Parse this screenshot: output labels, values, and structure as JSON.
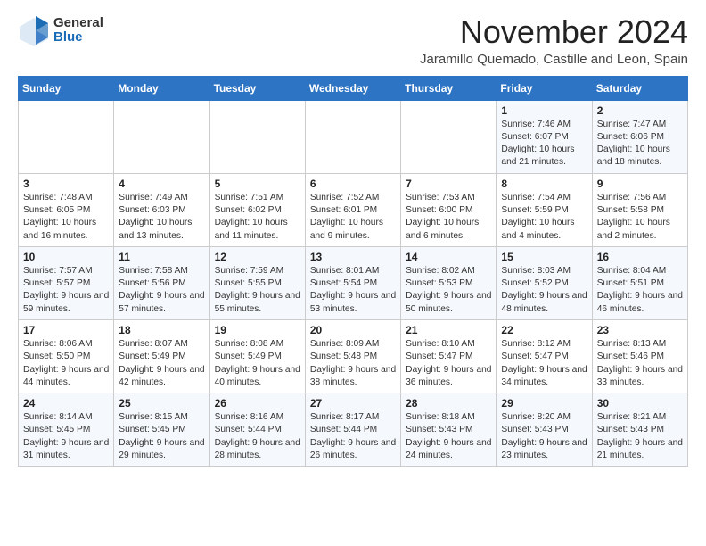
{
  "header": {
    "logo_general": "General",
    "logo_blue": "Blue",
    "month_title": "November 2024",
    "location": "Jaramillo Quemado, Castille and Leon, Spain"
  },
  "calendar": {
    "days_of_week": [
      "Sunday",
      "Monday",
      "Tuesday",
      "Wednesday",
      "Thursday",
      "Friday",
      "Saturday"
    ],
    "weeks": [
      [
        {
          "day": "",
          "info": ""
        },
        {
          "day": "",
          "info": ""
        },
        {
          "day": "",
          "info": ""
        },
        {
          "day": "",
          "info": ""
        },
        {
          "day": "",
          "info": ""
        },
        {
          "day": "1",
          "info": "Sunrise: 7:46 AM\nSunset: 6:07 PM\nDaylight: 10 hours and 21 minutes."
        },
        {
          "day": "2",
          "info": "Sunrise: 7:47 AM\nSunset: 6:06 PM\nDaylight: 10 hours and 18 minutes."
        }
      ],
      [
        {
          "day": "3",
          "info": "Sunrise: 7:48 AM\nSunset: 6:05 PM\nDaylight: 10 hours and 16 minutes."
        },
        {
          "day": "4",
          "info": "Sunrise: 7:49 AM\nSunset: 6:03 PM\nDaylight: 10 hours and 13 minutes."
        },
        {
          "day": "5",
          "info": "Sunrise: 7:51 AM\nSunset: 6:02 PM\nDaylight: 10 hours and 11 minutes."
        },
        {
          "day": "6",
          "info": "Sunrise: 7:52 AM\nSunset: 6:01 PM\nDaylight: 10 hours and 9 minutes."
        },
        {
          "day": "7",
          "info": "Sunrise: 7:53 AM\nSunset: 6:00 PM\nDaylight: 10 hours and 6 minutes."
        },
        {
          "day": "8",
          "info": "Sunrise: 7:54 AM\nSunset: 5:59 PM\nDaylight: 10 hours and 4 minutes."
        },
        {
          "day": "9",
          "info": "Sunrise: 7:56 AM\nSunset: 5:58 PM\nDaylight: 10 hours and 2 minutes."
        }
      ],
      [
        {
          "day": "10",
          "info": "Sunrise: 7:57 AM\nSunset: 5:57 PM\nDaylight: 9 hours and 59 minutes."
        },
        {
          "day": "11",
          "info": "Sunrise: 7:58 AM\nSunset: 5:56 PM\nDaylight: 9 hours and 57 minutes."
        },
        {
          "day": "12",
          "info": "Sunrise: 7:59 AM\nSunset: 5:55 PM\nDaylight: 9 hours and 55 minutes."
        },
        {
          "day": "13",
          "info": "Sunrise: 8:01 AM\nSunset: 5:54 PM\nDaylight: 9 hours and 53 minutes."
        },
        {
          "day": "14",
          "info": "Sunrise: 8:02 AM\nSunset: 5:53 PM\nDaylight: 9 hours and 50 minutes."
        },
        {
          "day": "15",
          "info": "Sunrise: 8:03 AM\nSunset: 5:52 PM\nDaylight: 9 hours and 48 minutes."
        },
        {
          "day": "16",
          "info": "Sunrise: 8:04 AM\nSunset: 5:51 PM\nDaylight: 9 hours and 46 minutes."
        }
      ],
      [
        {
          "day": "17",
          "info": "Sunrise: 8:06 AM\nSunset: 5:50 PM\nDaylight: 9 hours and 44 minutes."
        },
        {
          "day": "18",
          "info": "Sunrise: 8:07 AM\nSunset: 5:49 PM\nDaylight: 9 hours and 42 minutes."
        },
        {
          "day": "19",
          "info": "Sunrise: 8:08 AM\nSunset: 5:49 PM\nDaylight: 9 hours and 40 minutes."
        },
        {
          "day": "20",
          "info": "Sunrise: 8:09 AM\nSunset: 5:48 PM\nDaylight: 9 hours and 38 minutes."
        },
        {
          "day": "21",
          "info": "Sunrise: 8:10 AM\nSunset: 5:47 PM\nDaylight: 9 hours and 36 minutes."
        },
        {
          "day": "22",
          "info": "Sunrise: 8:12 AM\nSunset: 5:47 PM\nDaylight: 9 hours and 34 minutes."
        },
        {
          "day": "23",
          "info": "Sunrise: 8:13 AM\nSunset: 5:46 PM\nDaylight: 9 hours and 33 minutes."
        }
      ],
      [
        {
          "day": "24",
          "info": "Sunrise: 8:14 AM\nSunset: 5:45 PM\nDaylight: 9 hours and 31 minutes."
        },
        {
          "day": "25",
          "info": "Sunrise: 8:15 AM\nSunset: 5:45 PM\nDaylight: 9 hours and 29 minutes."
        },
        {
          "day": "26",
          "info": "Sunrise: 8:16 AM\nSunset: 5:44 PM\nDaylight: 9 hours and 28 minutes."
        },
        {
          "day": "27",
          "info": "Sunrise: 8:17 AM\nSunset: 5:44 PM\nDaylight: 9 hours and 26 minutes."
        },
        {
          "day": "28",
          "info": "Sunrise: 8:18 AM\nSunset: 5:43 PM\nDaylight: 9 hours and 24 minutes."
        },
        {
          "day": "29",
          "info": "Sunrise: 8:20 AM\nSunset: 5:43 PM\nDaylight: 9 hours and 23 minutes."
        },
        {
          "day": "30",
          "info": "Sunrise: 8:21 AM\nSunset: 5:43 PM\nDaylight: 9 hours and 21 minutes."
        }
      ]
    ]
  }
}
